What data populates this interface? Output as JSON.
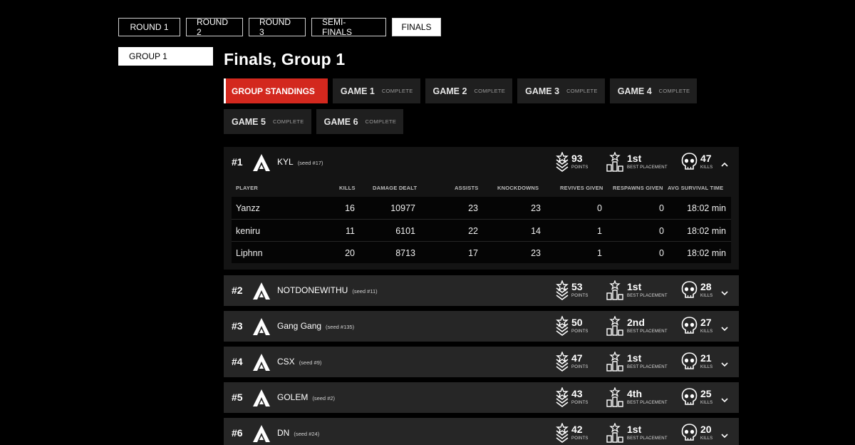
{
  "rounds": [
    {
      "label": "ROUND 1",
      "active": false
    },
    {
      "label": "ROUND 2",
      "active": false
    },
    {
      "label": "ROUND 3",
      "active": false
    },
    {
      "label": "SEMI-FINALS",
      "active": false
    },
    {
      "label": "FINALS",
      "active": true
    }
  ],
  "group": {
    "label": "GROUP 1"
  },
  "title": "Finals, Group 1",
  "game_tabs": [
    {
      "label": "GROUP STANDINGS",
      "status": ""
    },
    {
      "label": "GAME 1",
      "status": "COMPLETE"
    },
    {
      "label": "GAME 2",
      "status": "COMPLETE"
    },
    {
      "label": "GAME 3",
      "status": "COMPLETE"
    },
    {
      "label": "GAME 4",
      "status": "COMPLETE"
    },
    {
      "label": "GAME 5",
      "status": "COMPLETE"
    },
    {
      "label": "GAME 6",
      "status": "COMPLETE"
    }
  ],
  "stat_labels": {
    "points": "POINTS",
    "placement": "BEST PLACEMENT",
    "kills": "KILLS"
  },
  "detail_headers": {
    "player": "PLAYER",
    "kills": "KILLS",
    "damage": "DAMAGE DEALT",
    "assists": "ASSISTS",
    "knockdowns": "KNOCKDOWNS",
    "revives": "REVIVES GIVEN",
    "respawns": "RESPAWNS GIVEN",
    "survival": "AVG SURVIVAL TIME"
  },
  "teams": [
    {
      "rank": "#1",
      "name": "KYL",
      "seed": "(seed #17)",
      "points": "93",
      "placement": "1st",
      "kills": "47",
      "expanded": true,
      "players": [
        {
          "player": "Yanzz",
          "kills": "16",
          "damage": "10977",
          "assists": "23",
          "knockdowns": "23",
          "revives": "0",
          "respawns": "0",
          "survival": "18:02 min"
        },
        {
          "player": "keniru",
          "kills": "11",
          "damage": "6101",
          "assists": "22",
          "knockdowns": "14",
          "revives": "1",
          "respawns": "0",
          "survival": "18:02 min"
        },
        {
          "player": "Liphnn",
          "kills": "20",
          "damage": "8713",
          "assists": "17",
          "knockdowns": "23",
          "revives": "1",
          "respawns": "0",
          "survival": "18:02 min"
        }
      ]
    },
    {
      "rank": "#2",
      "name": "NOTDONEWITHU",
      "seed": "(seed #11)",
      "points": "53",
      "placement": "1st",
      "kills": "28",
      "expanded": false
    },
    {
      "rank": "#3",
      "name": "Gang Gang",
      "seed": "(seed #135)",
      "points": "50",
      "placement": "2nd",
      "kills": "27",
      "expanded": false
    },
    {
      "rank": "#4",
      "name": "CSX",
      "seed": "(seed #9)",
      "points": "47",
      "placement": "1st",
      "kills": "21",
      "expanded": false
    },
    {
      "rank": "#5",
      "name": "GOLEM",
      "seed": "(seed #2)",
      "points": "43",
      "placement": "4th",
      "kills": "25",
      "expanded": false
    },
    {
      "rank": "#6",
      "name": "DN",
      "seed": "(seed #24)",
      "points": "42",
      "placement": "1st",
      "kills": "20",
      "expanded": false
    }
  ],
  "colors": {
    "accent": "#d3281e",
    "card": "#262626",
    "background": "#000000"
  }
}
